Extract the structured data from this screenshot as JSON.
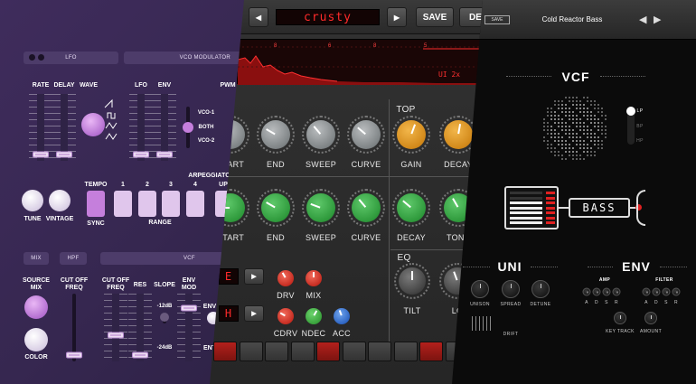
{
  "panel1": {
    "headers": {
      "lfo": "LFO",
      "vco_modulator": "VCO MODULATOR",
      "mix": "MIX",
      "hpf": "HPF",
      "vcf": "VCF"
    },
    "labels": {
      "rate": "RATE",
      "delay": "DELAY",
      "wave": "WAVE",
      "lfo": "LFO",
      "env": "ENV",
      "pwm": "PWM",
      "vco1": "VCO-1",
      "both": "BOTH",
      "vco2": "VCO-2",
      "tune": "TUNE",
      "vintage": "VINTAGE",
      "tempo": "TEMPO",
      "sync": "SYNC",
      "range": "RANGE",
      "arpeggiator": "ARPEGGIATOR",
      "up": "UP",
      "source_mix": "SOURCE MIX",
      "color": "COLOR",
      "cut_off_freq_hpf": "CUT OFF FREQ",
      "cut_off_freq_vcf": "CUT OFF FREQ",
      "res": "RES",
      "slope": "SLOPE",
      "slope_12": "-12dB",
      "slope_24": "-24dB",
      "env_mod": "ENV MOD",
      "env_right": "ENV",
      "ent": "ENT"
    },
    "range_buttons": [
      "1",
      "2",
      "3",
      "4"
    ]
  },
  "panel2": {
    "display": "crusty",
    "save": "SAVE",
    "del": "DEL",
    "prev_icon": "triangle-left-icon",
    "next_icon": "triangle-right-icon",
    "spectrum_numbers": [
      "8",
      "6",
      "8",
      "5"
    ],
    "spectrum_readout": "UI 2x",
    "section_top": "TOP",
    "section_eq": "EQ",
    "row1": [
      "START",
      "END",
      "SWEEP",
      "CURVE",
      "GAIN",
      "DECAY"
    ],
    "row2": [
      "START",
      "END",
      "SWEEP",
      "CURVE",
      "DECAY",
      "TONE"
    ],
    "row3": [
      "DRV",
      "MIX",
      "CDRV",
      "NDEC",
      "ACC",
      "TILT",
      "LO"
    ],
    "mini_displays": [
      "E",
      "H"
    ],
    "step_states": [
      true,
      false,
      false,
      false,
      true,
      false,
      false,
      false,
      true,
      false
    ]
  },
  "panel3": {
    "save": "SAVE",
    "preset": "Cold Reactor Bass",
    "vcf_title": "VCF",
    "filter_modes": [
      "LP",
      "BP",
      "HP"
    ],
    "screen_text": "BASS",
    "uni_title": "UNI",
    "env_title": "ENV",
    "uni_knobs": [
      "UNISON",
      "SPREAD",
      "DETUNE"
    ],
    "drift": "DRIFT",
    "amp": "AMP",
    "filter": "FILTER",
    "adsr": [
      "A",
      "D",
      "S",
      "R"
    ],
    "key_track": "KEY TRACK",
    "amount": "AMOUNT"
  }
}
